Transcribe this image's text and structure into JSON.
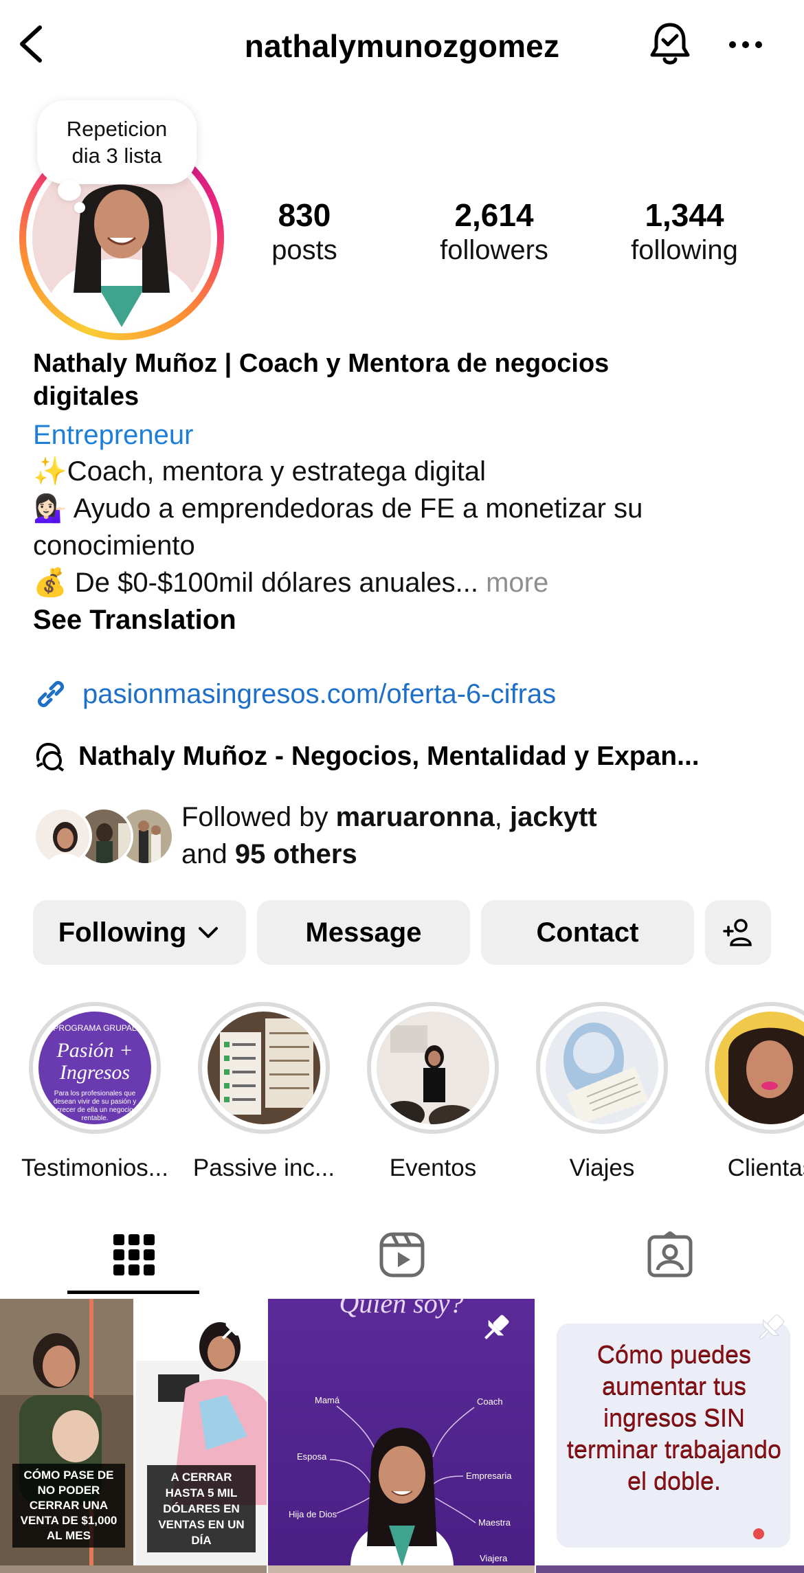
{
  "header": {
    "username": "nathalymunozgomez",
    "back_icon": "chevron-left-icon",
    "bell_icon": "bell-check-icon",
    "more_icon": "more-horizontal-icon"
  },
  "note": {
    "text_line1": "Repeticion",
    "text_line2": "dia 3 lista"
  },
  "stats": [
    {
      "value": "830",
      "label": "posts"
    },
    {
      "value": "2,614",
      "label": "followers"
    },
    {
      "value": "1,344",
      "label": "following"
    }
  ],
  "bio": {
    "name_line1": "Nathaly Muñoz | Coach y Mentora de negocios",
    "name_line2": "digitales",
    "category": "Entrepreneur",
    "line1": "✨Coach, mentora y estratega digital",
    "line2": "💁🏻‍♀️ Ayudo a emprendedoras de FE a monetizar su",
    "line3": "conocimiento",
    "line4": "💰 De $0-$100mil dólares anuales...",
    "more": "more",
    "see_translation": "See Translation"
  },
  "link": {
    "url": "pasionmasingresos.com/oferta-6-cifras"
  },
  "threads": {
    "text": "Nathaly Muñoz - Negocios, Mentalidad y Expan..."
  },
  "followed_by": {
    "prefix": "Followed by",
    "name1": "maruaronna",
    "separator": ",",
    "name2": "jackytt",
    "and": "and",
    "others": "95 others"
  },
  "actions": {
    "following": "Following",
    "message": "Message",
    "contact": "Contact"
  },
  "highlights": [
    {
      "label": "Testimonios...",
      "cover_title": "Pasión + Ingresos",
      "cover_top": "PROGRAMA GRUPAL",
      "cover_sub": "Para los profesionales que desean vivir de su pasión y crecer de ella un negocio rentable."
    },
    {
      "label": "Passive inc..."
    },
    {
      "label": "Eventos"
    },
    {
      "label": "Viajes"
    },
    {
      "label": "Clientas"
    }
  ],
  "tabs": [
    {
      "name": "grid",
      "icon": "grid-icon"
    },
    {
      "name": "reels",
      "icon": "reels-icon"
    },
    {
      "name": "tagged",
      "icon": "tagged-person-icon"
    }
  ],
  "posts": [
    {
      "left_caption": "CÓMO PASE DE NO PODER CERRAR UNA VENTA DE $1,000 AL MES",
      "right_caption": "A CERRAR HASTA 5 MIL DÓLARES EN VENTAS EN UN DÍA",
      "pinned": true
    },
    {
      "title": "Quien soy?",
      "words": [
        "Mamá",
        "Esposa",
        "Hija de Dios",
        "Coach",
        "Empresaria",
        "Maestra",
        "Viajera"
      ],
      "pinned": true
    },
    {
      "text": "Cómo puedes aumentar tus ingresos SIN terminar trabajando el doble.",
      "pinned": true
    }
  ],
  "colors": {
    "link_blue": "#1e6fc7",
    "category_blue": "#1e7fd8",
    "button_gray": "#efefef",
    "purple": "#5b2a98"
  }
}
